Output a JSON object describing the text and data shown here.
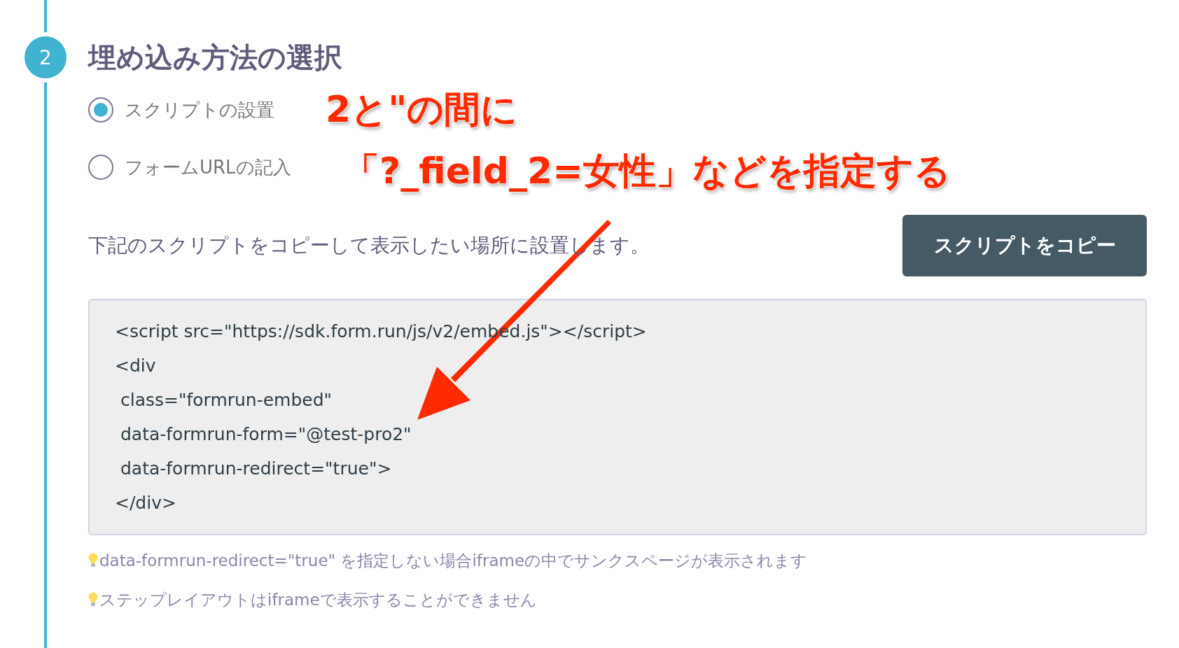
{
  "step": {
    "number": "2",
    "title": "埋め込み方法の選択"
  },
  "options": [
    {
      "label": "スクリプトの設置",
      "selected": true
    },
    {
      "label": "フォームURLの記入",
      "selected": false
    }
  ],
  "description": "下記のスクリプトをコピーして表示したい場所に設置します。",
  "copy_button": "スクリプトをコピー",
  "code_lines": [
    "<script src=\"https://sdk.form.run/js/v2/embed.js\"></script>",
    "<div",
    " class=\"formrun-embed\"",
    " data-formrun-form=\"@test-pro2\"",
    " data-formrun-redirect=\"true\">",
    "</div>"
  ],
  "tips": [
    "data-formrun-redirect=\"true\" を指定しない場合iframeの中でサンクスページが表示されます",
    "ステップレイアウトはiframeで表示することができません"
  ],
  "annotation": {
    "lines": [
      "2と\"の間に",
      "「?_field_2=女性」などを指定する"
    ]
  }
}
